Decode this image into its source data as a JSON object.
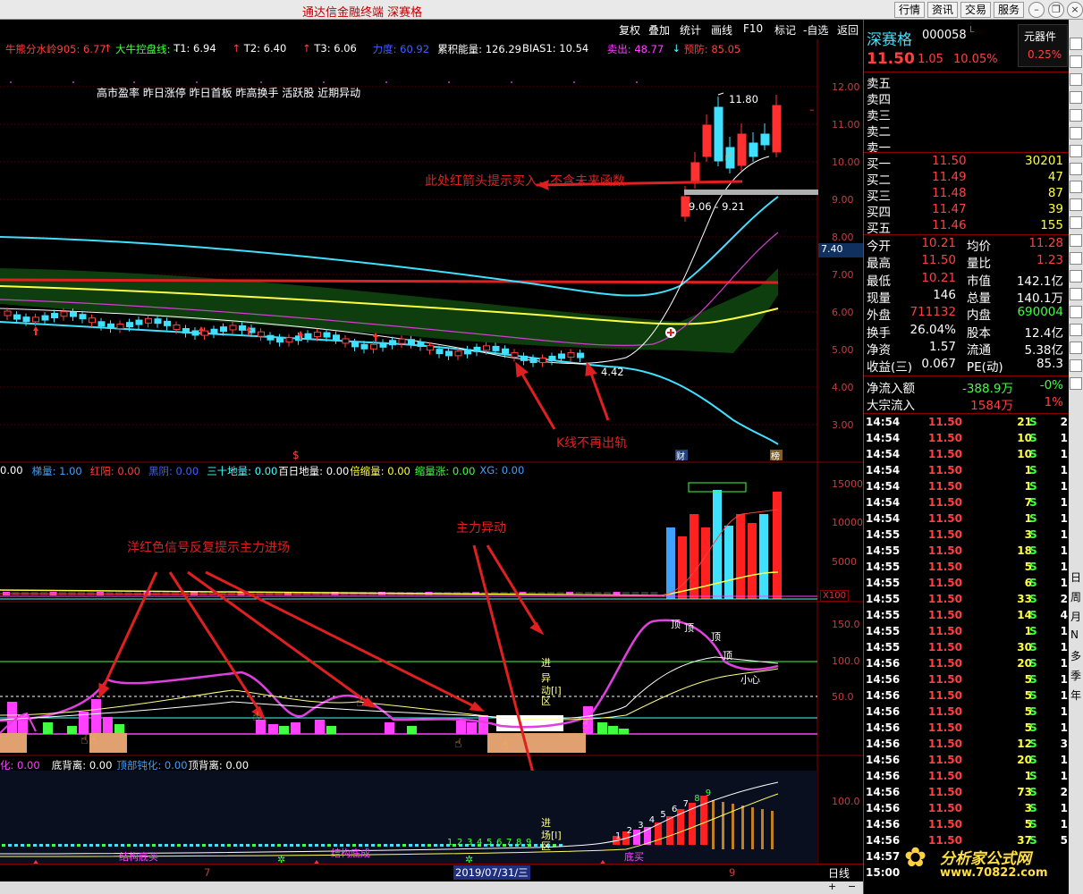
{
  "app": {
    "title": "通达信金融终端 深赛格"
  },
  "top_buttons": [
    "行情",
    "资讯",
    "交易",
    "服务"
  ],
  "toolbar": [
    "复权",
    "叠加",
    "统计",
    "画线",
    "F10",
    "标记",
    "-自选",
    "返回"
  ],
  "main_indicators": [
    {
      "text": "牛熊分水岭905: 6.77",
      "color": "#ff4040"
    },
    {
      "text": "↑",
      "color": "#ff4040"
    },
    {
      "text": "大牛控盘线: -",
      "color": "#40ff40"
    },
    {
      "text": "T1: 6.94",
      "color": "#ffffff"
    },
    {
      "text": "↑",
      "color": "#ff4040"
    },
    {
      "text": "T2: 6.40",
      "color": "#ffffff"
    },
    {
      "text": "↑",
      "color": "#ff4040"
    },
    {
      "text": "T3: 6.06",
      "color": "#ffffff"
    },
    {
      "text": "力度: 60.92",
      "color": "#4060ff"
    },
    {
      "text": "累积能量: 126.29",
      "color": "#ffffff"
    },
    {
      "text": "BIAS1: 10.54",
      "color": "#ffffff"
    },
    {
      "text": "卖出: 48.77",
      "color": "#ff40ff"
    },
    {
      "text": "↓",
      "color": "#40ffff"
    },
    {
      "text": "预防: 85.05",
      "color": "#ff4040"
    }
  ],
  "tags_line": "高市盈率 昨日涨停 昨日首板 昨高换手 活跃股 近期异动",
  "price_axis": [
    "12.00",
    "11.00",
    "10.00",
    "9.00",
    "8.00",
    "7.00",
    "6.00",
    "5.00",
    "4.00",
    "3.00"
  ],
  "price_badge": "7.40",
  "price_marks": {
    "high": "11.80",
    "low": "4.42",
    "range": "9.06 - 9.21"
  },
  "badges": {
    "cai": "财",
    "bang": "榜"
  },
  "annotations": {
    "buy_arrow": "此处红箭头提示买入，不含未来函数",
    "k_line": "K线不再出轨",
    "red_signal": "洋红色信号反复提示主力进场",
    "main_force": "主力异动"
  },
  "volume_indicators": [
    {
      "text": "0.00",
      "color": "#ffffff"
    },
    {
      "text": "梯量: 1.00",
      "color": "#40a0ff"
    },
    {
      "text": "红阳: 0.00",
      "color": "#ff4040"
    },
    {
      "text": "黑阴: 0.00",
      "color": "#4060ff"
    },
    {
      "text": "三十地量: 0.00",
      "color": "#40ffff"
    },
    {
      "text": "百日地量: 0.00",
      "color": "#ffffff"
    },
    {
      "text": "倍缩量: 0.00",
      "color": "#ffff40"
    },
    {
      "text": "缩量涨: 0.00",
      "color": "#40ff40"
    },
    {
      "text": "XG: 0.00",
      "color": "#40a0ff"
    }
  ],
  "vol_axis": [
    "15000",
    "10000",
    "5000"
  ],
  "vol_unit": "X100",
  "osc_axis": [
    "150.0",
    "100.0",
    "50.0"
  ],
  "osc_labels": {
    "top1": "顶",
    "top2": "顶",
    "top3": "顶",
    "top4": "顶",
    "heart": "小心",
    "stack": [
      "进",
      "异",
      "动[l]",
      "区"
    ]
  },
  "div_indicators": [
    {
      "text": "化: 0.00",
      "color": "#ff40ff"
    },
    {
      "text": "底背离: 0.00",
      "color": "#ffffff"
    },
    {
      "text": "顶部钝化: 0.00",
      "color": "#40a0ff"
    },
    {
      "text": "顶背离: 0.00",
      "color": "#ffffff"
    }
  ],
  "div_axis": [
    "100.0"
  ],
  "div_labels": {
    "bottom_buy": "结构底买",
    "struct": "结构底成",
    "bottom": "底买",
    "stack": [
      "进",
      "场[l]",
      "区"
    ],
    "seq": [
      "1",
      "2",
      "3",
      "4",
      "5",
      "6",
      "7",
      "8",
      "9"
    ],
    "rise": [
      "1",
      "2",
      "3",
      "4",
      "5",
      "6",
      "7",
      "8",
      "9"
    ]
  },
  "dates": {
    "d7": "7",
    "cursor": "2019/07/31/三",
    "d9": "9"
  },
  "period": "日线",
  "stock": {
    "name": "深赛格",
    "code": "000058",
    "mark": "L",
    "tool": "元器件",
    "price": "11.50",
    "change": "1.05",
    "pct": "10.05%",
    "tool_pct": "0.25%"
  },
  "asks": [
    "卖五",
    "卖四",
    "卖三",
    "卖二",
    "卖一"
  ],
  "bids": [
    {
      "label": "买一",
      "price": "11.50",
      "vol": "30201"
    },
    {
      "label": "买二",
      "price": "11.49",
      "vol": "47"
    },
    {
      "label": "买三",
      "price": "11.48",
      "vol": "87"
    },
    {
      "label": "买四",
      "price": "11.47",
      "vol": "39"
    },
    {
      "label": "买五",
      "price": "11.46",
      "vol": "155"
    }
  ],
  "stats": [
    {
      "l1": "今开",
      "v1": "10.21",
      "c1": "#ff4040",
      "l2": "均价",
      "v2": "11.28",
      "c2": "#ff4040"
    },
    {
      "l1": "最高",
      "v1": "11.50",
      "c1": "#ff4040",
      "l2": "量比",
      "v2": "1.23",
      "c2": "#ff4040"
    },
    {
      "l1": "最低",
      "v1": "10.21",
      "c1": "#ff4040",
      "l2": "市值",
      "v2": "142.1亿",
      "c2": "#ffffff"
    },
    {
      "l1": "现量",
      "v1": "146",
      "c1": "#ffffff",
      "l2": "总量",
      "v2": "140.1万",
      "c2": "#ffffff"
    },
    {
      "l1": "外盘",
      "v1": "711132",
      "c1": "#ff4040",
      "l2": "内盘",
      "v2": "690004",
      "c2": "#40ff40"
    },
    {
      "l1": "换手",
      "v1": "26.04%",
      "c1": "#ffffff",
      "l2": "股本",
      "v2": "12.4亿",
      "c2": "#ffffff"
    },
    {
      "l1": "净资",
      "v1": "1.57",
      "c1": "#ffffff",
      "l2": "流通",
      "v2": "5.38亿",
      "c2": "#ffffff"
    },
    {
      "l1": "收益(三)",
      "v1": "0.067",
      "c1": "#ffffff",
      "l2": "PE(动)",
      "v2": "85.3",
      "c2": "#ffffff"
    }
  ],
  "flows": [
    {
      "label": "净流入额",
      "v1": "-388.9万",
      "c1": "#40ff40",
      "v2": "-0%",
      "c2": "#40ff40"
    },
    {
      "label": "大宗流入",
      "v1": "1584万",
      "c1": "#ff4040",
      "v2": "1%",
      "c2": "#ff4040"
    }
  ],
  "ticks": [
    {
      "t": "14:54",
      "p": "11.50",
      "v": "21",
      "s": "S",
      "n": "2"
    },
    {
      "t": "14:54",
      "p": "11.50",
      "v": "10",
      "s": "S",
      "n": "1"
    },
    {
      "t": "14:54",
      "p": "11.50",
      "v": "10",
      "s": "S",
      "n": "1"
    },
    {
      "t": "14:54",
      "p": "11.50",
      "v": "1",
      "s": "S",
      "n": "1"
    },
    {
      "t": "14:54",
      "p": "11.50",
      "v": "1",
      "s": "S",
      "n": "1"
    },
    {
      "t": "14:54",
      "p": "11.50",
      "v": "7",
      "s": "S",
      "n": "1"
    },
    {
      "t": "14:54",
      "p": "11.50",
      "v": "1",
      "s": "S",
      "n": "1"
    },
    {
      "t": "14:55",
      "p": "11.50",
      "v": "3",
      "s": "S",
      "n": "1"
    },
    {
      "t": "14:55",
      "p": "11.50",
      "v": "18",
      "s": "S",
      "n": "1"
    },
    {
      "t": "14:55",
      "p": "11.50",
      "v": "5",
      "s": "S",
      "n": "1"
    },
    {
      "t": "14:55",
      "p": "11.50",
      "v": "6",
      "s": "S",
      "n": "1"
    },
    {
      "t": "14:55",
      "p": "11.50",
      "v": "33",
      "s": "S",
      "n": "2"
    },
    {
      "t": "14:55",
      "p": "11.50",
      "v": "14",
      "s": "S",
      "n": "4"
    },
    {
      "t": "14:55",
      "p": "11.50",
      "v": "1",
      "s": "S",
      "n": "1"
    },
    {
      "t": "14:55",
      "p": "11.50",
      "v": "30",
      "s": "S",
      "n": "1"
    },
    {
      "t": "14:56",
      "p": "11.50",
      "v": "20",
      "s": "S",
      "n": "1"
    },
    {
      "t": "14:56",
      "p": "11.50",
      "v": "5",
      "s": "S",
      "n": "1"
    },
    {
      "t": "14:56",
      "p": "11.50",
      "v": "5",
      "s": "S",
      "n": "1"
    },
    {
      "t": "14:56",
      "p": "11.50",
      "v": "5",
      "s": "S",
      "n": "1"
    },
    {
      "t": "14:56",
      "p": "11.50",
      "v": "5",
      "s": "S",
      "n": "1"
    },
    {
      "t": "14:56",
      "p": "11.50",
      "v": "12",
      "s": "S",
      "n": "3"
    },
    {
      "t": "14:56",
      "p": "11.50",
      "v": "20",
      "s": "S",
      "n": "1"
    },
    {
      "t": "14:56",
      "p": "11.50",
      "v": "1",
      "s": "S",
      "n": "1"
    },
    {
      "t": "14:56",
      "p": "11.50",
      "v": "73",
      "s": "S",
      "n": "2"
    },
    {
      "t": "14:56",
      "p": "11.50",
      "v": "3",
      "s": "S",
      "n": "1"
    },
    {
      "t": "14:56",
      "p": "11.50",
      "v": "5",
      "s": "S",
      "n": "1"
    },
    {
      "t": "14:56",
      "p": "11.50",
      "v": "37",
      "s": "S",
      "n": "5"
    },
    {
      "t": "14:57",
      "p": "",
      "v": "",
      "s": "",
      "n": ""
    },
    {
      "t": "15:00",
      "p": "",
      "v": "",
      "s": "",
      "n": ""
    }
  ],
  "side_tabs": [
    "日",
    "周",
    "月",
    "N",
    "多",
    "季",
    "年"
  ],
  "watermark": {
    "name": "分析家公式网",
    "url": "www.70822.com"
  }
}
